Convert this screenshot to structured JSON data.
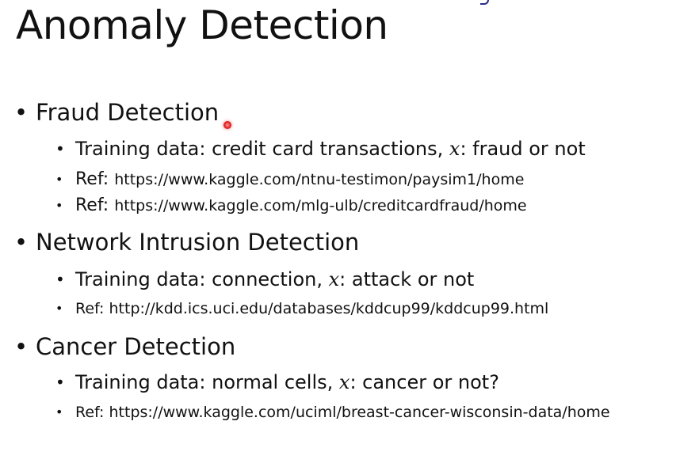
{
  "slide": {
    "title": "Anomaly Detection"
  },
  "sections": [
    {
      "heading": "Fraud Detection",
      "training": {
        "prefix": "Training data: credit card transactions, ",
        "var": "x",
        "suffix": ": fraud or not"
      },
      "refs": [
        {
          "label": "Ref: ",
          "url": "https://www.kaggle.com/ntnu-testimon/paysim1/home"
        },
        {
          "label": "Ref: ",
          "url": "https://www.kaggle.com/mlg-ulb/creditcardfraud/home"
        }
      ]
    },
    {
      "heading": "Network Intrusion Detection",
      "training": {
        "prefix": "Training data: connection, ",
        "var": "x",
        "suffix": ": attack or not"
      },
      "refs": [
        {
          "label": "Ref: ",
          "url": "http://kdd.ics.uci.edu/databases/kddcup99/kddcup99.html"
        }
      ]
    },
    {
      "heading": "Cancer Detection",
      "training": {
        "prefix": "Training data: normal cells, ",
        "var": "x",
        "suffix": ": cancer or not?"
      },
      "refs": [
        {
          "label": "Ref: ",
          "url": "https://www.kaggle.com/uciml/breast-cancer-wisconsin-data/home"
        }
      ]
    }
  ],
  "colors": {
    "text": "#111111",
    "background": "#ffffff",
    "laser_pointer": "#e02020"
  },
  "bullet_glyph": "•"
}
